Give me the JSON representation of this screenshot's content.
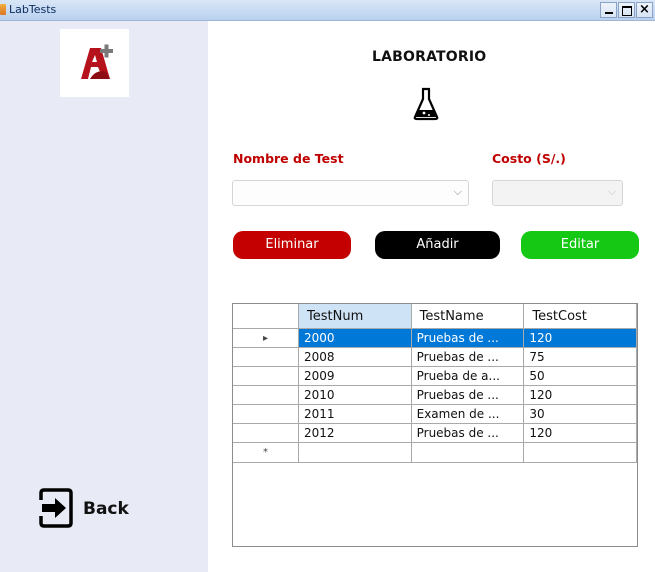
{
  "window": {
    "title": "LabTests"
  },
  "sidebar": {
    "back_label": "Back"
  },
  "main": {
    "heading": "LABORATORIO",
    "label_name": "Nombre de Test",
    "label_cost": "Costo (S/.)",
    "combo_name_value": "",
    "combo_cost_value": "",
    "buttons": {
      "delete": "Eliminar",
      "add": "Añadir",
      "edit": "Editar"
    }
  },
  "grid": {
    "columns": [
      "TestNum",
      "TestName",
      "TestCost"
    ],
    "rows": [
      [
        "2000",
        "Pruebas de ...",
        "120"
      ],
      [
        "2008",
        "Pruebas de ...",
        "75"
      ],
      [
        "2009",
        "Prueba de a...",
        "50"
      ],
      [
        "2010",
        "Pruebas de ...",
        "120"
      ],
      [
        "2011",
        "Examen de ...",
        "30"
      ],
      [
        "2012",
        "Pruebas de ...",
        "120"
      ]
    ],
    "current_row_marker": "▸",
    "new_row_marker": "*"
  },
  "colors": {
    "accent_red": "#c00000",
    "delete_button": "#c40000",
    "add_button": "#000000",
    "edit_button": "#14c814",
    "selection": "#0078d7",
    "sidebar_bg": "#e8eaf5"
  }
}
